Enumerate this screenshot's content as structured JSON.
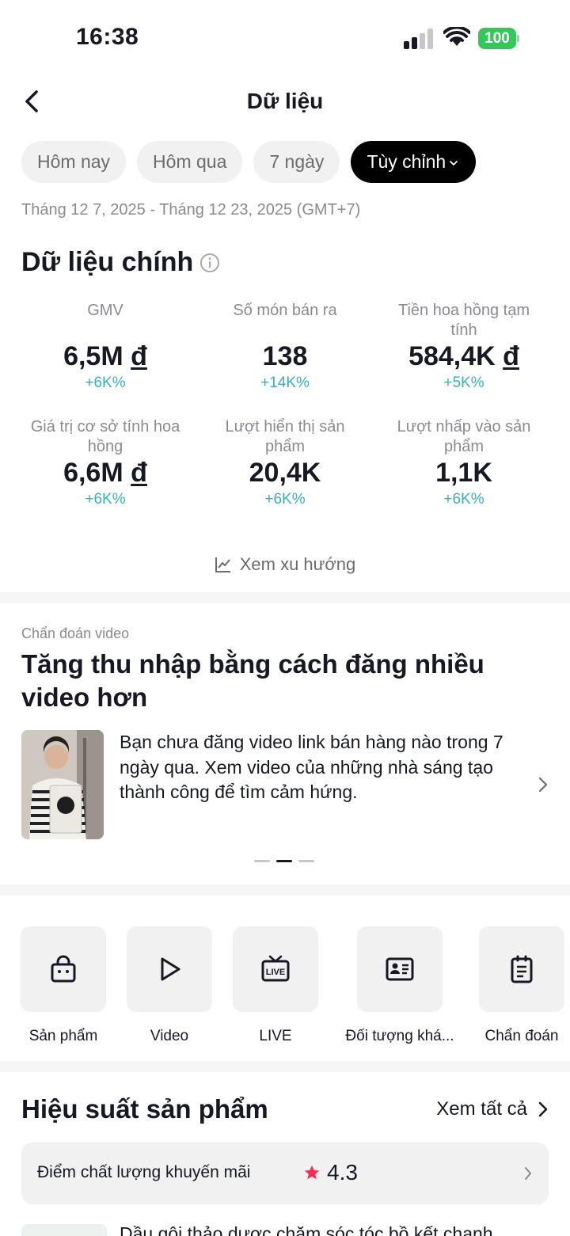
{
  "status_bar": {
    "time": "16:38",
    "battery": "100"
  },
  "nav": {
    "title": "Dữ liệu"
  },
  "filters": {
    "chips": [
      "Hôm nay",
      "Hôm qua",
      "7 ngày",
      "Tùy chỉnh"
    ],
    "active_index": 3
  },
  "date_range": "Tháng 12 7, 2025 - Tháng 12 23, 2025 (GMT+7)",
  "main_data": {
    "title": "Dữ liệu chính",
    "metrics": [
      {
        "label": "GMV",
        "value": "6,5M",
        "currency": "đ",
        "delta": "+6K%"
      },
      {
        "label": "Số món bán ra",
        "value": "138",
        "currency": "",
        "delta": "+14K%"
      },
      {
        "label": "Tiền hoa hồng tạm tính",
        "value": "584,4K",
        "currency": "đ",
        "delta": "+5K%"
      },
      {
        "label": "Giá trị cơ sở tính hoa hồng",
        "value": "6,6M",
        "currency": "đ",
        "delta": "+6K%"
      },
      {
        "label": "Lượt hiển thị sản phẩm",
        "value": "20,4K",
        "currency": "",
        "delta": "+6K%"
      },
      {
        "label": "Lượt nhấp vào sản phẩm",
        "value": "1,1K",
        "currency": "",
        "delta": "+6K%"
      }
    ],
    "trend_link": "Xem xu hướng"
  },
  "diagnosis": {
    "label": "Chẩn đoán video",
    "title": "Tăng thu nhập bằng cách đăng nhiều video hơn",
    "body": "Bạn chưa đăng video link bán hàng nào trong 7 ngày qua. Xem video của những nhà sáng tạo thành công để tìm cảm hứng.",
    "pager_total": 3,
    "pager_active": 1
  },
  "shortcuts": [
    {
      "label": "Sản phẩm",
      "icon": "shopping-bag-icon"
    },
    {
      "label": "Video",
      "icon": "play-icon"
    },
    {
      "label": "LIVE",
      "icon": "live-tv-icon"
    },
    {
      "label": "Đối tượng khá...",
      "icon": "id-card-icon"
    },
    {
      "label": "Chẩn đoán",
      "icon": "clipboard-icon"
    }
  ],
  "product_performance": {
    "title": "Hiệu suất sản phẩm",
    "see_all": "Xem tất cả",
    "promo_label": "Điểm chất lượng khuyến mãi",
    "promo_score": "4.3",
    "first_product": "Dầu gội thảo dược chăm sóc tóc bồ kết chanh"
  },
  "colors": {
    "delta_positive": "#3bb0ba",
    "battery": "#34c759",
    "star": "#fe2c55",
    "active_chip": "#000000"
  }
}
